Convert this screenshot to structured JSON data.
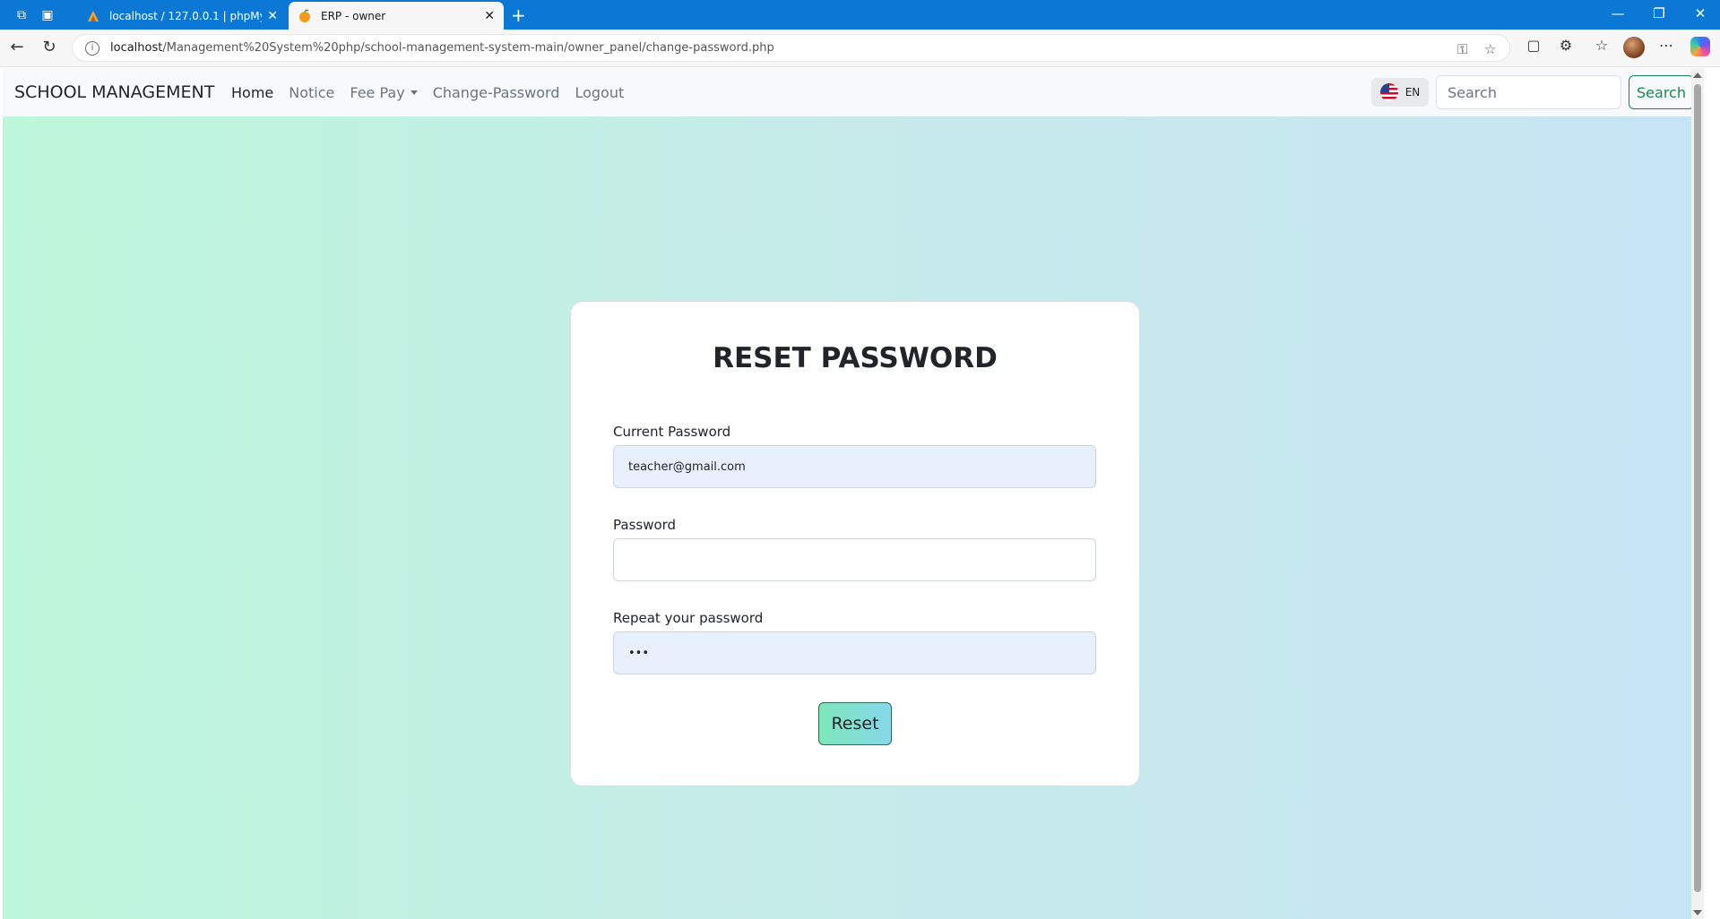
{
  "browser": {
    "tabs": [
      {
        "title": "localhost / 127.0.0.1 | phpMyAdmin",
        "favicon": "phpmyadmin-icon"
      },
      {
        "title": "ERP - owner",
        "favicon": "orange-icon"
      }
    ],
    "url_host": "localhost",
    "url_path": "/Management%20System%20php/school-management-system-main/owner_panel/change-password.php"
  },
  "navbar": {
    "brand": "SCHOOL MANAGEMENT",
    "links": [
      "Home",
      "Notice",
      "Fee Pay",
      "Change-Password",
      "Logout"
    ],
    "language": "EN",
    "search_placeholder": "Search",
    "search_button": "Search"
  },
  "form": {
    "title": "RESET PASSWORD",
    "current_password_label": "Current Password",
    "current_password_value": "teacher@gmail.com",
    "password_label": "Password",
    "password_value": "",
    "repeat_label": "Repeat your password",
    "repeat_value": "•••",
    "reset_button": "Reset"
  },
  "colors": {
    "accent_green": "#198754",
    "gradient_left": "#bdf7db",
    "gradient_right": "#c6e4f4"
  }
}
